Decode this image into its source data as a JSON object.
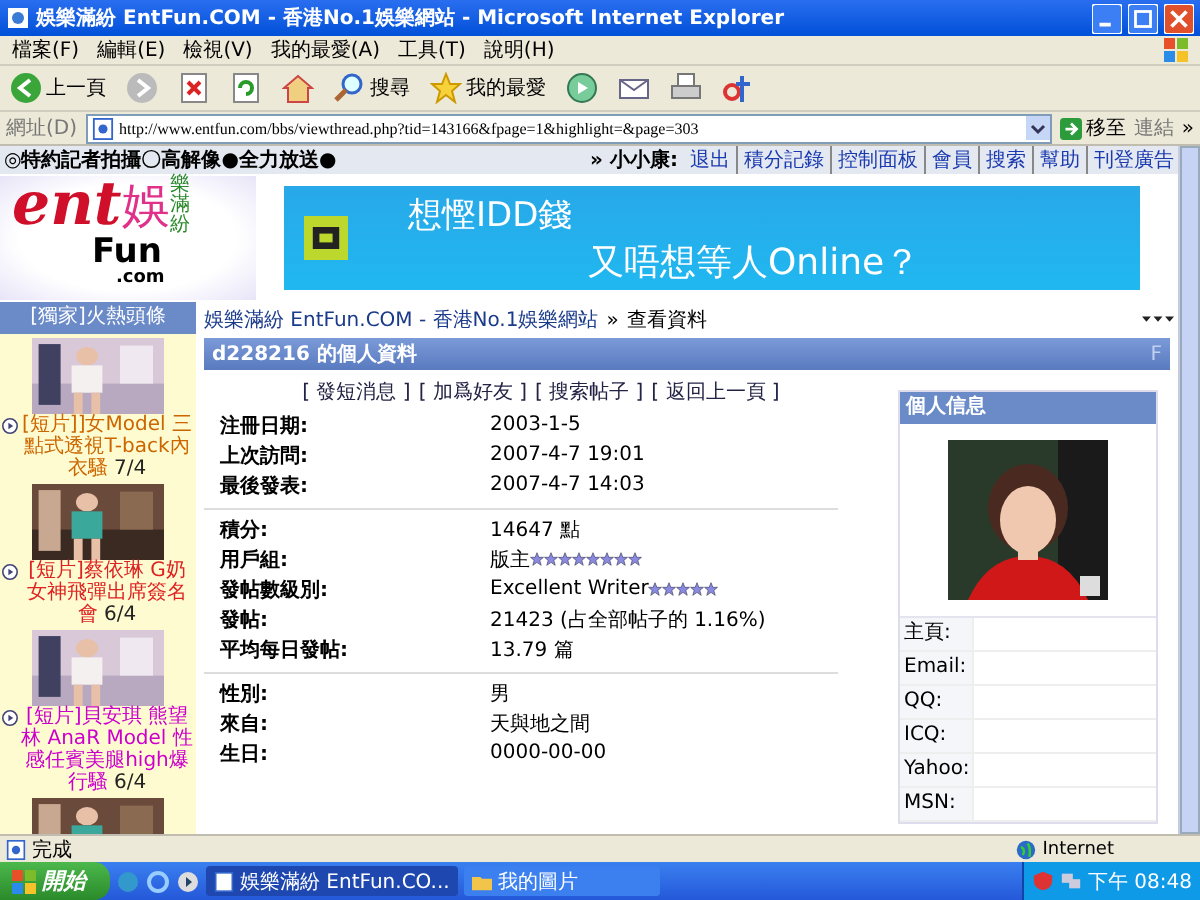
{
  "window": {
    "title": "娛樂滿紛 EntFun.COM - 香港No.1娛樂網站 - Microsoft Internet Explorer"
  },
  "menu": [
    "檔案(F)",
    "編輯(E)",
    "檢視(V)",
    "我的最愛(A)",
    "工具(T)",
    "說明(H)"
  ],
  "toolbar": [
    {
      "kind": "back",
      "label": "上一頁"
    },
    {
      "kind": "forward"
    },
    {
      "kind": "stop"
    },
    {
      "kind": "refresh"
    },
    {
      "kind": "home"
    },
    {
      "kind": "search",
      "label": "搜尋"
    },
    {
      "kind": "favorites",
      "label": "我的最愛"
    },
    {
      "kind": "media"
    },
    {
      "kind": "mail"
    },
    {
      "kind": "print"
    },
    {
      "kind": "translate"
    }
  ],
  "address": {
    "label": "網址(D)",
    "url": "http://www.entfun.com/bbs/viewthread.php?tid=143166&fpage=1&highlight=&page=303",
    "go": "移至",
    "links": "連結",
    "more": "»"
  },
  "topstrip": {
    "notice": "◎特約記者拍攝〇高解像●全力放送●",
    "user": "» 小小康:",
    "links": [
      "退出",
      "積分記錄",
      "控制面板",
      "會員",
      "搜索",
      "幫助",
      "刊登廣告"
    ]
  },
  "logo": {
    "ent": "ent",
    "chinese": "娛",
    "vertical": "樂滿紛",
    "fun": "Fun",
    "com": ".com"
  },
  "banner": {
    "headline": "想慳IDD錢",
    "subline": "又唔想等人Online？"
  },
  "sidebar": {
    "title": "[獨家]火熱頭條",
    "items": [
      {
        "kind": "story",
        "title": "[短片]]女Model 三點式透視T-back內衣騷",
        "date": "7/4",
        "color": "#cc6600"
      },
      {
        "kind": "story",
        "title": "[短片]蔡依琳 G奶女神飛彈出席簽名會",
        "date": "6/4",
        "color": "#dd2222"
      },
      {
        "kind": "story",
        "title": "[短片]貝安琪 熊望林 AnaR Model 性感任賓美腿high爆行騷",
        "date": "6/4",
        "color": "#cc00cc"
      },
      {
        "kind": "picture"
      }
    ]
  },
  "breadcrumb": {
    "site": "娛樂滿紛 EntFun.COM - 香港No.1娛樂網站",
    "separator": "»",
    "current": "查看資料"
  },
  "profile": {
    "title": "d228216 的個人資料",
    "corner": "F",
    "actions": [
      "[ 發短消息 ]",
      "[ 加爲好友 ]",
      "[ 搜索帖子 ]",
      "[ 返回上一頁 ]"
    ],
    "groups": [
      [
        {
          "label": "注冊日期:",
          "value": "2003-1-5"
        },
        {
          "label": "上次訪問:",
          "value": "2007-4-7 19:01"
        },
        {
          "label": "最後發表:",
          "value": "2007-4-7 14:03"
        }
      ],
      [
        {
          "label": "積分:",
          "value": "14647 點"
        },
        {
          "label": "用戶組:",
          "value": "版主",
          "stars": 8
        },
        {
          "label": "發帖數級別:",
          "value": "Excellent Writer",
          "stars": 5
        },
        {
          "label": "發帖:",
          "value": "21423 (占全部帖子的 1.16%)"
        },
        {
          "label": "平均每日發帖:",
          "value": "13.79 篇"
        }
      ],
      [
        {
          "label": "性別:",
          "value": "男"
        },
        {
          "label": "來自:",
          "value": "天與地之間"
        },
        {
          "label": "生日:",
          "value": "0000-00-00"
        }
      ]
    ]
  },
  "info": {
    "title": "個人信息",
    "fields": [
      "主頁:",
      "Email:",
      "QQ:",
      "ICQ:",
      "Yahoo:",
      "MSN:"
    ]
  },
  "status": {
    "text": "完成",
    "zone": "Internet"
  },
  "taskbar": {
    "start": "開始",
    "tasks": [
      {
        "label": "娛樂滿紛 EntFun.CO...",
        "selected": true
      },
      {
        "label": "我的圖片",
        "selected": false
      }
    ],
    "clock": "下午 08:48"
  }
}
